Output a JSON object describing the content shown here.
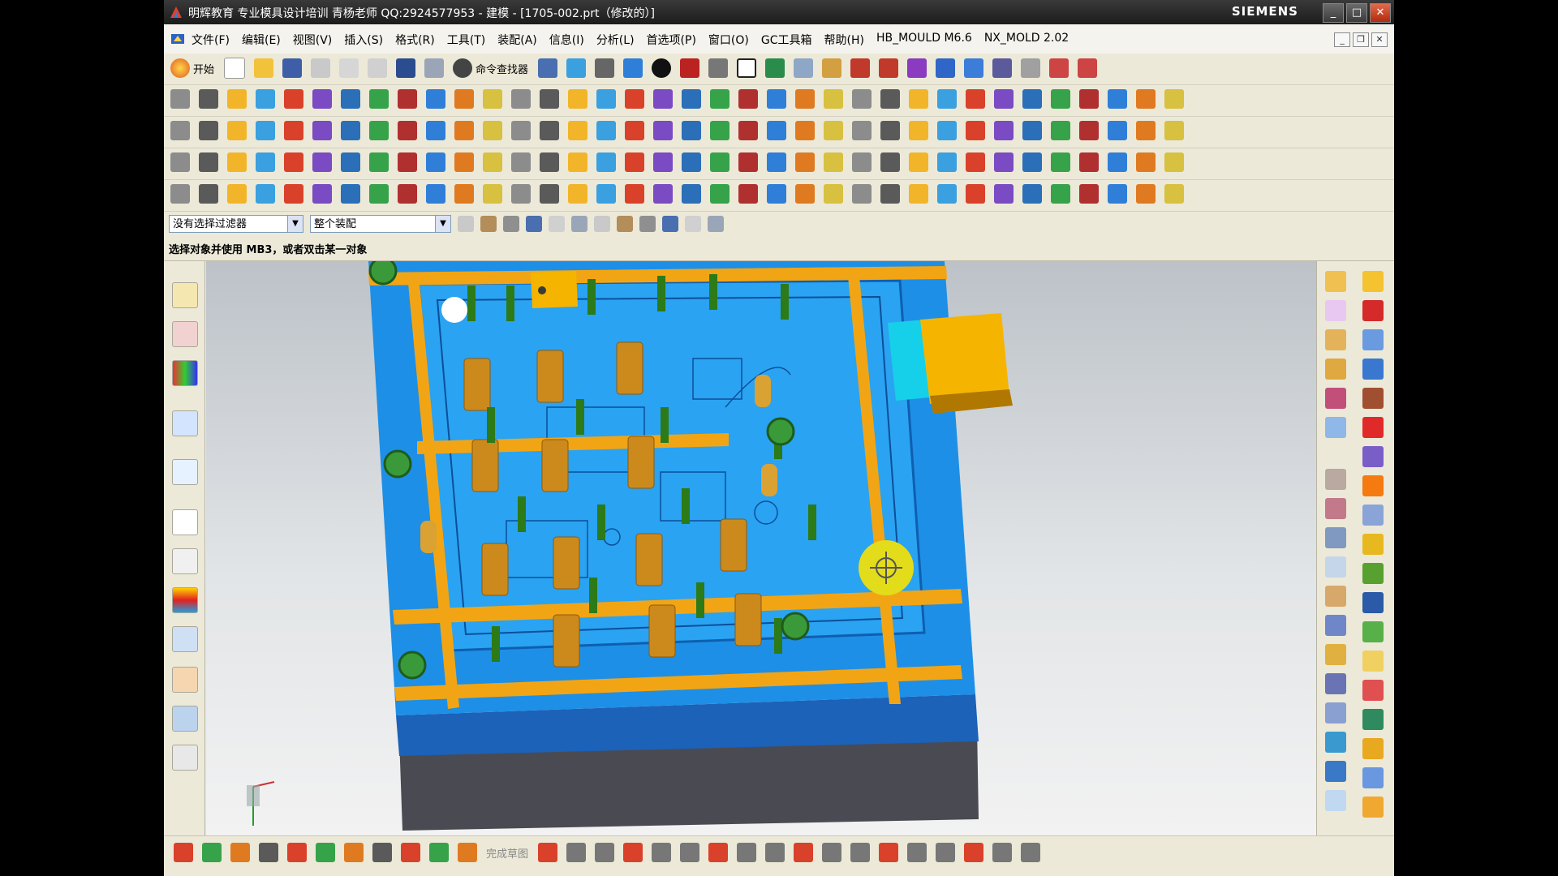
{
  "window": {
    "title": "明辉教育 专业模具设计培训 青杨老师  QQ:2924577953 - 建模 - [1705-002.prt（修改的）]",
    "brand": "SIEMENS",
    "buttons": {
      "minimize": "_",
      "maximize": "□",
      "close": "✕"
    }
  },
  "menubar": {
    "items": [
      "文件(F)",
      "编辑(E)",
      "视图(V)",
      "插入(S)",
      "格式(R)",
      "工具(T)",
      "装配(A)",
      "信息(I)",
      "分析(L)",
      "首选项(P)",
      "窗口(O)",
      "GC工具箱",
      "帮助(H)",
      "HB_MOULD M6.6",
      "NX_MOLD 2.02"
    ]
  },
  "toolbar1": {
    "start_label": "开始",
    "command_finder_label": "命令查找器"
  },
  "selection_bar": {
    "filter_value": "没有选择过滤器",
    "scope_value": "整个装配"
  },
  "status": {
    "prompt": "选择对象并使用 MB3，或者双击某一对象"
  },
  "bottom_toolbar": {
    "sketch_label": "完成草图"
  },
  "colors": {
    "plate": "#1e8fe6",
    "frame": "#f2a514",
    "pin": "#cc8a1c",
    "core": "#2d7a18",
    "slider": "#f5b400",
    "cursor": "#e3dc1a"
  },
  "icons": {
    "toolbar1": [
      "undo-icon",
      "redo-icon",
      "command-finder-icon",
      "snap-icon",
      "selection-icon",
      "render-icon",
      "view-icon",
      "shade-icon",
      "background-icon",
      "layer-icon",
      "orient-icon",
      "wcs-icon",
      "csys-icon",
      "point-icon",
      "line-icon",
      "arc-icon"
    ],
    "left": [
      "assembly-navigator-icon",
      "part-navigator-icon",
      "reuse-library-icon",
      "hd3d-icon",
      "web-browser-icon",
      "history-icon",
      "system-materials-icon",
      "palette-icon",
      "process-studio-icon",
      "role-icon",
      "system-scene-icon",
      "manufacturing-icon"
    ]
  }
}
